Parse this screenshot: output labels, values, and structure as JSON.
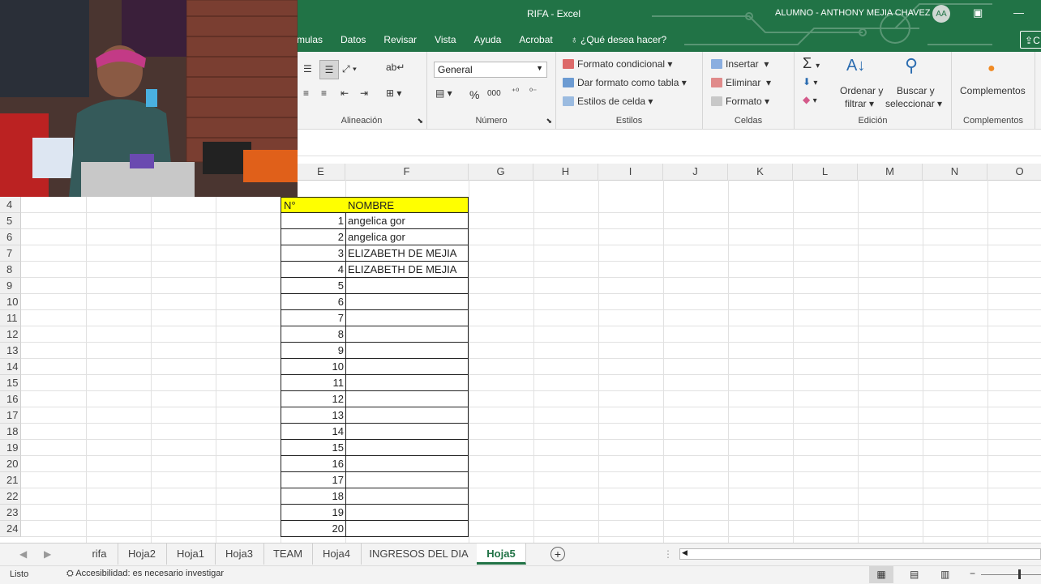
{
  "window": {
    "title": "RIFA  -  Excel",
    "user_name": "ALUMNO - ANTHONY MEJIA CHAVEZ",
    "user_initials": "AA"
  },
  "ribbon_tabs": [
    "mulas",
    "Datos",
    "Revisar",
    "Vista",
    "Ayuda",
    "Acrobat"
  ],
  "tell_me": "¿Qué desea hacer?",
  "share_label": "C",
  "ribbon": {
    "alignment_label": "Alineación",
    "number_label": "Número",
    "number_format": "General",
    "percent": "%",
    "thousands": "000",
    "styles_label": "Estilos",
    "conditional_format": "Formato condicional",
    "format_as_table": "Dar formato como tabla",
    "cell_styles": "Estilos de celda",
    "cells_label": "Celdas",
    "insert": "Insertar",
    "delete": "Eliminar",
    "format": "Formato",
    "editing_label": "Edición",
    "sort_filter_1": "Ordenar y",
    "sort_filter_2": "filtrar",
    "find_select_1": "Buscar y",
    "find_select_2": "seleccionar",
    "addins": "Complementos",
    "addins_label": "Complementos"
  },
  "columns": [
    "E",
    "F",
    "G",
    "H",
    "I",
    "J",
    "K",
    "L",
    "M",
    "N",
    "O"
  ],
  "rows": [
    4,
    5,
    6,
    7,
    8,
    9,
    10,
    11,
    12,
    13,
    14,
    15,
    16,
    17,
    18,
    19,
    20,
    21,
    22,
    23,
    24
  ],
  "table": {
    "header_num": "N°",
    "header_name": "NOMBRE",
    "entries": [
      {
        "n": "1",
        "name": "angelica gor"
      },
      {
        "n": "2",
        "name": "angelica gor"
      },
      {
        "n": "3",
        "name": "ELIZABETH DE MEJIA"
      },
      {
        "n": "4",
        "name": "ELIZABETH DE MEJIA"
      },
      {
        "n": "5",
        "name": ""
      },
      {
        "n": "6",
        "name": ""
      },
      {
        "n": "7",
        "name": ""
      },
      {
        "n": "8",
        "name": ""
      },
      {
        "n": "9",
        "name": ""
      },
      {
        "n": "10",
        "name": ""
      },
      {
        "n": "11",
        "name": ""
      },
      {
        "n": "12",
        "name": ""
      },
      {
        "n": "13",
        "name": ""
      },
      {
        "n": "14",
        "name": ""
      },
      {
        "n": "15",
        "name": ""
      },
      {
        "n": "16",
        "name": ""
      },
      {
        "n": "17",
        "name": ""
      },
      {
        "n": "18",
        "name": ""
      },
      {
        "n": "19",
        "name": ""
      },
      {
        "n": "20",
        "name": ""
      }
    ]
  },
  "sheets": [
    "rifa",
    "Hoja2",
    "Hoja1",
    "Hoja3",
    "TEAM",
    "Hoja4",
    "INGRESOS DEL DIA",
    "Hoja5"
  ],
  "active_sheet": "Hoja5",
  "status": {
    "ready": "Listo",
    "accessibility": "Accesibilidad: es necesario investigar"
  },
  "colors": {
    "excel_green": "#217346",
    "header_fill": "#ffff00"
  }
}
